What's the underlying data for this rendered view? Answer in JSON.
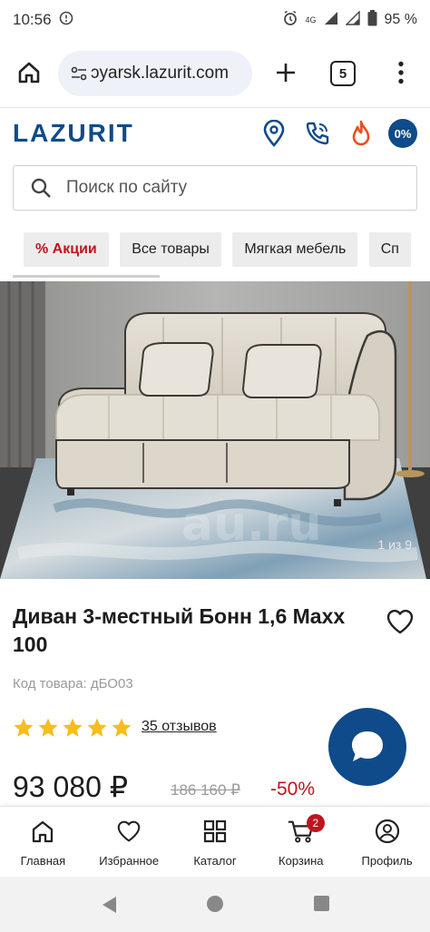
{
  "status_bar": {
    "time": "10:56",
    "network": "4G",
    "battery": "95 %"
  },
  "browser": {
    "url": "ɔyarsk.lazurit.com",
    "tab_count": "5"
  },
  "site": {
    "logo": "LAZURIT",
    "badge": "0%",
    "brand_color": "#0f4a8a",
    "accent_color": "#c0141e"
  },
  "search": {
    "placeholder": "Поиск по сайту"
  },
  "categories": [
    {
      "label": "% Акции",
      "active": true
    },
    {
      "label": "Все товары",
      "active": false
    },
    {
      "label": "Мягкая мебель",
      "active": false
    },
    {
      "label": "Сп",
      "active": false
    }
  ],
  "gallery": {
    "counter": "1 из 9"
  },
  "product": {
    "title": "Диван 3-местный Бонн 1,6 Maxx 100",
    "sku": "Код товара: дБО03",
    "rating": 5,
    "reviews": "35 отзывов",
    "price": "93 080 ₽",
    "old_price": "186 160 ₽",
    "discount": "-50%"
  },
  "bottom_nav": [
    {
      "label": "Главная",
      "icon": "home-icon"
    },
    {
      "label": "Избранное",
      "icon": "heart-icon"
    },
    {
      "label": "Каталог",
      "icon": "grid-icon"
    },
    {
      "label": "Корзина",
      "icon": "cart-icon",
      "badge": "2"
    },
    {
      "label": "Профиль",
      "icon": "profile-icon"
    }
  ]
}
